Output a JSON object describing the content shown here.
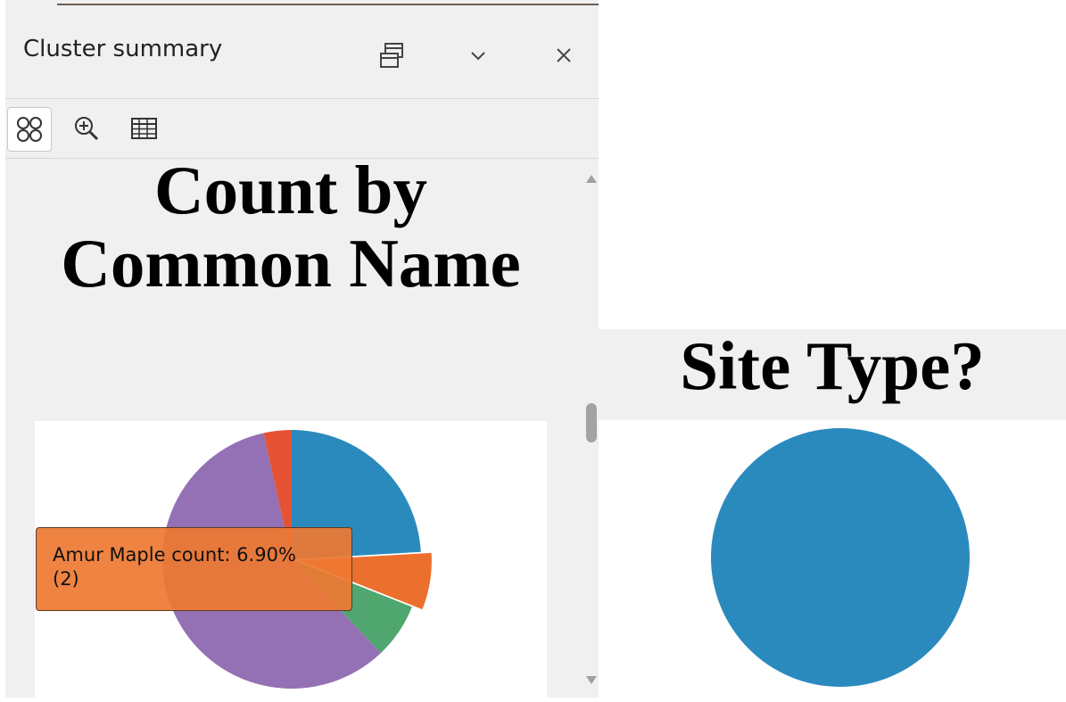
{
  "panel": {
    "title": "Cluster summary",
    "header_icons": [
      "restore-window-icon",
      "chevron-down-icon",
      "close-icon"
    ],
    "toolbar_icons": [
      "cluster-icon",
      "zoom-to-icon",
      "table-icon"
    ]
  },
  "left_chart": {
    "title": "Count by Common Name",
    "tooltip_line1": "Amur Maple count: 6.90%",
    "tooltip_line2": "(2)"
  },
  "right_chart": {
    "title": "Site Type?"
  },
  "chart_data": [
    {
      "type": "pie",
      "title": "Count by Common Name",
      "slices": [
        {
          "label": "",
          "value": 24.1,
          "color": "#2b8abd"
        },
        {
          "label": "Amur Maple",
          "value": 6.9,
          "count": 2,
          "color": "#ec702d"
        },
        {
          "label": "",
          "value": 6.9,
          "color": "#4fa66e"
        },
        {
          "label": "",
          "value": 58.6,
          "color": "#9470b4"
        },
        {
          "label": "",
          "value": 3.5,
          "color": "#e55334"
        }
      ],
      "highlighted": "Amur Maple"
    },
    {
      "type": "pie",
      "title": "Site Type?",
      "slices": [
        {
          "label": "",
          "value": 100,
          "color": "#2b8abd"
        }
      ]
    }
  ]
}
